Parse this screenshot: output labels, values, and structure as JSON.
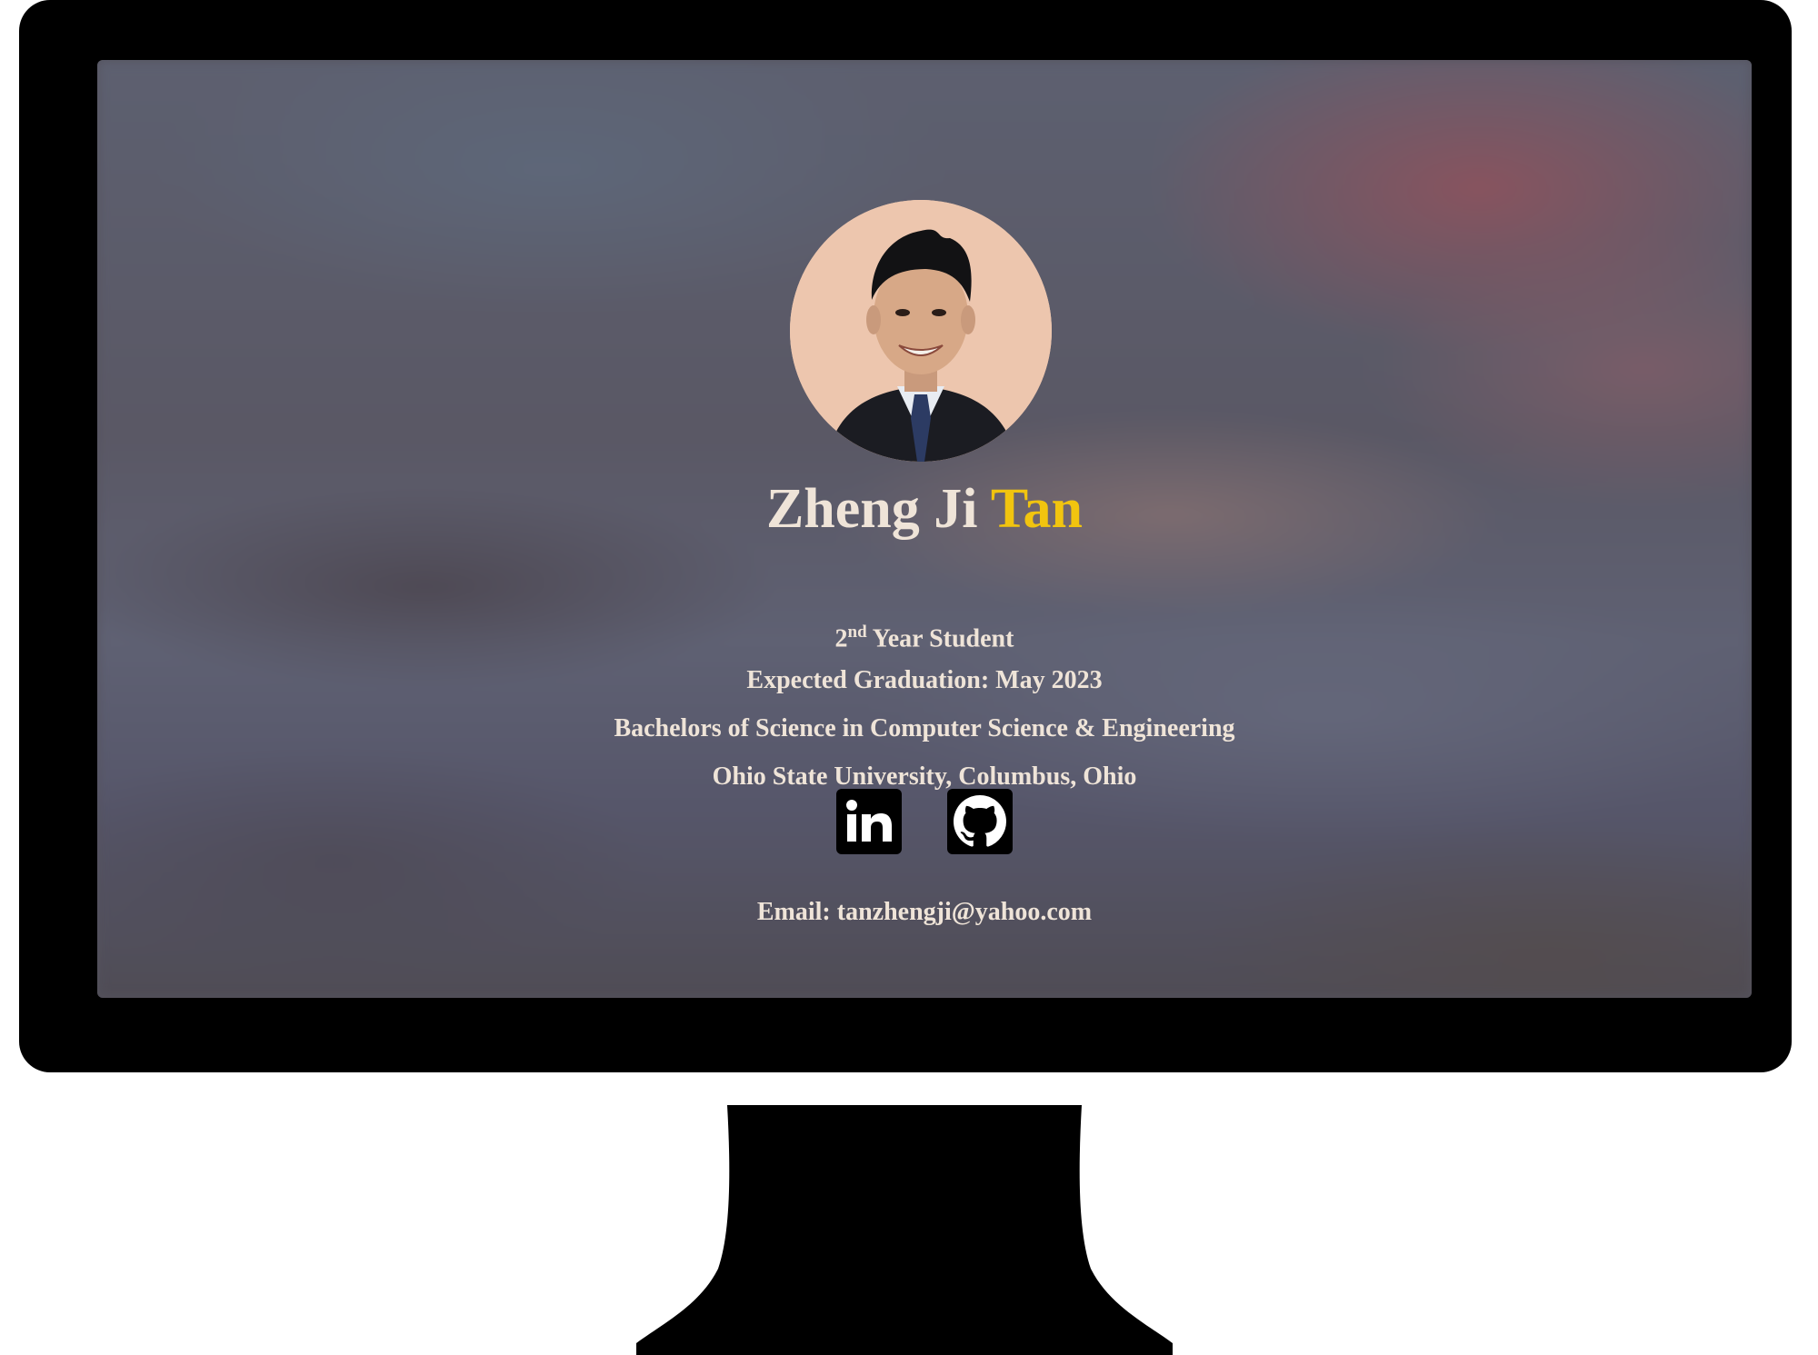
{
  "profile": {
    "first_names": "Zheng Ji",
    "surname": "Tan",
    "year_number": "2",
    "year_suffix": "nd",
    "year_text": "Year Student",
    "graduation": "Expected Graduation: May 2023",
    "degree": "Bachelors of Science in Computer Science & Engineering",
    "university": "Ohio State University, Columbus, Ohio",
    "email_label": "Email:",
    "email": "tanzhengji@yahoo.com"
  },
  "socials": [
    {
      "icon": "linkedin-icon"
    },
    {
      "icon": "github-icon"
    }
  ],
  "colors": {
    "accent": "#f1c40f",
    "text": "#efe4d8",
    "avatar_bg": "#edc6ae",
    "bezel": "#000000"
  }
}
